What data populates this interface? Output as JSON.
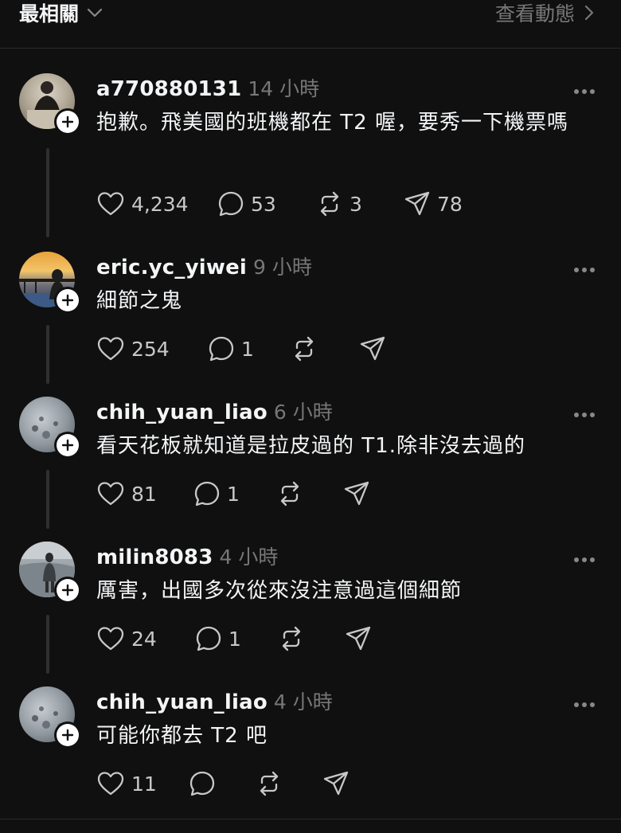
{
  "header": {
    "sort_label": "最相關",
    "activity_label": "查看動態"
  },
  "comments": [
    {
      "username": "a770880131",
      "time": "14 小時",
      "text": "抱歉。飛美國的班機都在 T2 喔，要秀一下機票嗎",
      "likes": "4,234",
      "replies": "53",
      "reposts": "3",
      "shares": "78"
    },
    {
      "username": "eric.yc_yiwei",
      "time": "9 小時",
      "text": "細節之鬼",
      "likes": "254",
      "replies": "1",
      "reposts": "",
      "shares": ""
    },
    {
      "username": "chih_yuan_liao",
      "time": "6 小時",
      "text": "看天花板就知道是拉皮過的 T1.除非沒去過的",
      "likes": "81",
      "replies": "1",
      "reposts": "",
      "shares": ""
    },
    {
      "username": "milin8083",
      "time": "4 小時",
      "text": "厲害，出國多次從來沒注意過這個細節",
      "likes": "24",
      "replies": "1",
      "reposts": "",
      "shares": ""
    },
    {
      "username": "chih_yuan_liao",
      "time": "4 小時",
      "text": "可能你都去 T2 吧",
      "likes": "11",
      "replies": "",
      "reposts": "",
      "shares": ""
    }
  ],
  "icons": {
    "like": "heart-icon",
    "reply": "comment-bubble-icon",
    "repost": "repost-icon",
    "share": "send-icon",
    "more": "more-dots-icon",
    "follow": "plus-icon",
    "sort_chevron": "chevron-down-icon",
    "activity_chevron": "chevron-right-icon"
  },
  "colors": {
    "background": "#101010",
    "text_primary": "#f3f5f7",
    "text_secondary": "#777777",
    "divider": "#2a2a2a"
  }
}
